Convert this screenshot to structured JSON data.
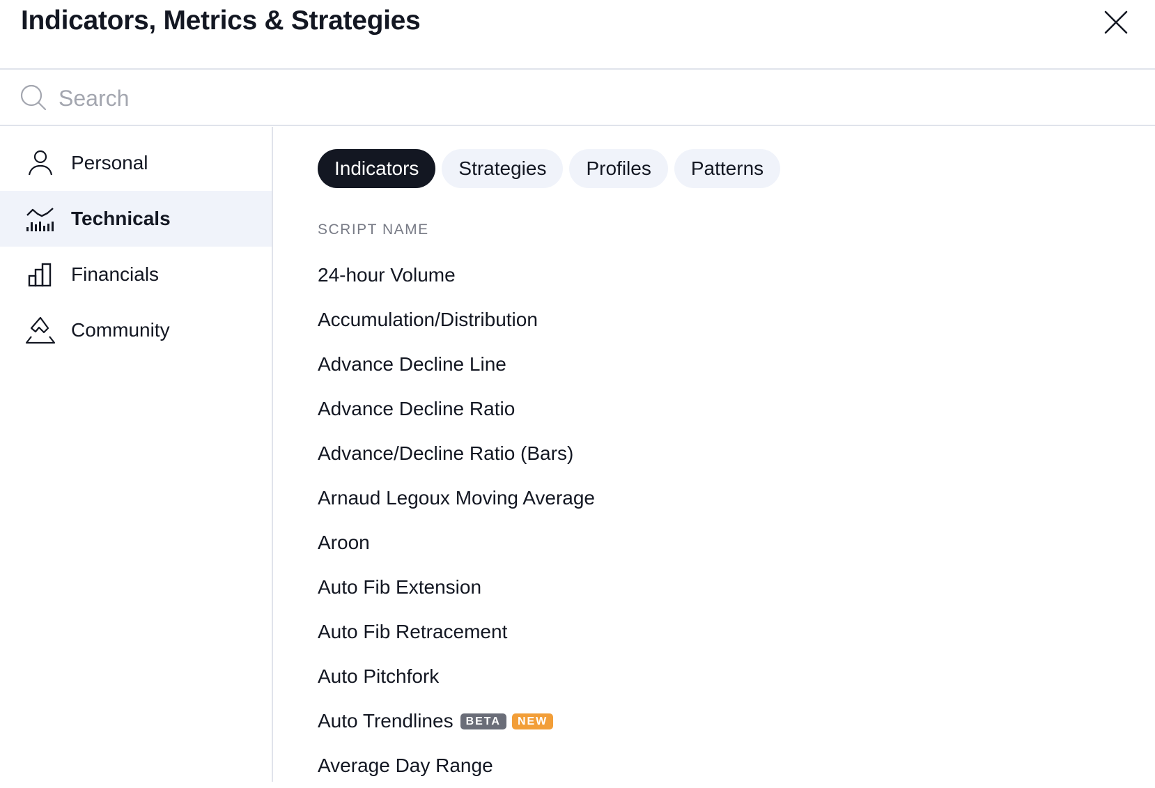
{
  "header": {
    "title": "Indicators, Metrics & Strategies",
    "close_icon": "close-icon"
  },
  "search": {
    "placeholder": "Search",
    "value": "",
    "icon": "search-icon"
  },
  "sidebar": {
    "items": [
      {
        "label": "Personal",
        "icon": "person-icon",
        "active": false
      },
      {
        "label": "Technicals",
        "icon": "technicals-chart-icon",
        "active": true
      },
      {
        "label": "Financials",
        "icon": "bar-chart-icon",
        "active": false
      },
      {
        "label": "Community",
        "icon": "community-mountain-icon",
        "active": false
      }
    ]
  },
  "main": {
    "tabs": [
      {
        "label": "Indicators",
        "active": true
      },
      {
        "label": "Strategies",
        "active": false
      },
      {
        "label": "Profiles",
        "active": false
      },
      {
        "label": "Patterns",
        "active": false
      }
    ],
    "column_header": "SCRIPT NAME",
    "scripts": [
      {
        "name": "24-hour Volume"
      },
      {
        "name": "Accumulation/Distribution"
      },
      {
        "name": "Advance Decline Line"
      },
      {
        "name": "Advance Decline Ratio"
      },
      {
        "name": "Advance/Decline Ratio (Bars)"
      },
      {
        "name": "Arnaud Legoux Moving Average"
      },
      {
        "name": "Aroon"
      },
      {
        "name": "Auto Fib Extension"
      },
      {
        "name": "Auto Fib Retracement"
      },
      {
        "name": "Auto Pitchfork"
      },
      {
        "name": "Auto Trendlines",
        "badges": [
          "BETA",
          "NEW"
        ]
      },
      {
        "name": "Average Day Range"
      }
    ]
  },
  "colors": {
    "text": "#131722",
    "active_tab_bg": "#131722",
    "inactive_tab_bg": "#f0f3fa",
    "sidebar_active_bg": "#f0f3fa",
    "beta_badge": "#6a6d78",
    "new_badge": "#f29e38",
    "divider": "#e0e3eb",
    "muted_text": "#787b86"
  }
}
